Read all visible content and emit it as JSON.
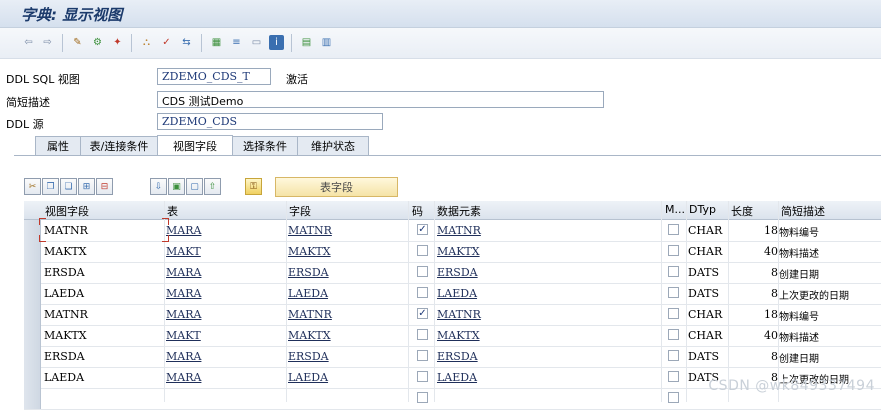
{
  "window": {
    "title": "字典: 显示视图"
  },
  "form": {
    "ddl_sql_view_label": "DDL SQL 视图",
    "ddl_sql_view_value": "ZDEMO_CDS_T",
    "status": "激活",
    "short_desc_label": "简短描述",
    "short_desc_value": "CDS 测试Demo",
    "ddl_source_label": "DDL 源",
    "ddl_source_value": "ZDEMO_CDS"
  },
  "tabs": [
    {
      "label": "属性"
    },
    {
      "label": "表/连接条件"
    },
    {
      "label": "视图字段"
    },
    {
      "label": "选择条件"
    },
    {
      "label": "维护状态"
    }
  ],
  "active_tab": "视图字段",
  "table_toolbar": {
    "table_fields_button": "表字段"
  },
  "columns": {
    "view_field": "视图字段",
    "table": "表",
    "field": "字段",
    "key": "码",
    "data_element": "数据元素",
    "m": "M...",
    "dtype": "DTyp",
    "length": "长度",
    "short_desc": "简短描述"
  },
  "rows": [
    {
      "view_field": "MATNR",
      "table": "MARA",
      "field": "MATNR",
      "key": true,
      "data_element": "MATNR",
      "m": false,
      "dtype": "CHAR",
      "length": "18",
      "desc": "物料编号"
    },
    {
      "view_field": "MAKTX",
      "table": "MAKT",
      "field": "MAKTX",
      "key": false,
      "data_element": "MAKTX",
      "m": false,
      "dtype": "CHAR",
      "length": "40",
      "desc": "物料描述"
    },
    {
      "view_field": "ERSDA",
      "table": "MARA",
      "field": "ERSDA",
      "key": false,
      "data_element": "ERSDA",
      "m": false,
      "dtype": "DATS",
      "length": "8",
      "desc": "创建日期"
    },
    {
      "view_field": "LAEDA",
      "table": "MARA",
      "field": "LAEDA",
      "key": false,
      "data_element": "LAEDA",
      "m": false,
      "dtype": "DATS",
      "length": "8",
      "desc": "上次更改的日期"
    },
    {
      "view_field": "MATNR",
      "table": "MARA",
      "field": "MATNR",
      "key": true,
      "data_element": "MATNR",
      "m": false,
      "dtype": "CHAR",
      "length": "18",
      "desc": "物料编号"
    },
    {
      "view_field": "MAKTX",
      "table": "MAKT",
      "field": "MAKTX",
      "key": false,
      "data_element": "MAKTX",
      "m": false,
      "dtype": "CHAR",
      "length": "40",
      "desc": "物料描述"
    },
    {
      "view_field": "ERSDA",
      "table": "MARA",
      "field": "ERSDA",
      "key": false,
      "data_element": "ERSDA",
      "m": false,
      "dtype": "DATS",
      "length": "8",
      "desc": "创建日期"
    },
    {
      "view_field": "LAEDA",
      "table": "MARA",
      "field": "LAEDA",
      "key": false,
      "data_element": "LAEDA",
      "m": false,
      "dtype": "DATS",
      "length": "8",
      "desc": "上次更改的日期"
    },
    {
      "view_field": "",
      "table": "",
      "field": "",
      "key": false,
      "data_element": "",
      "m": false,
      "dtype": "",
      "length": "",
      "desc": ""
    }
  ],
  "watermark": "CSDN @wk849337494"
}
